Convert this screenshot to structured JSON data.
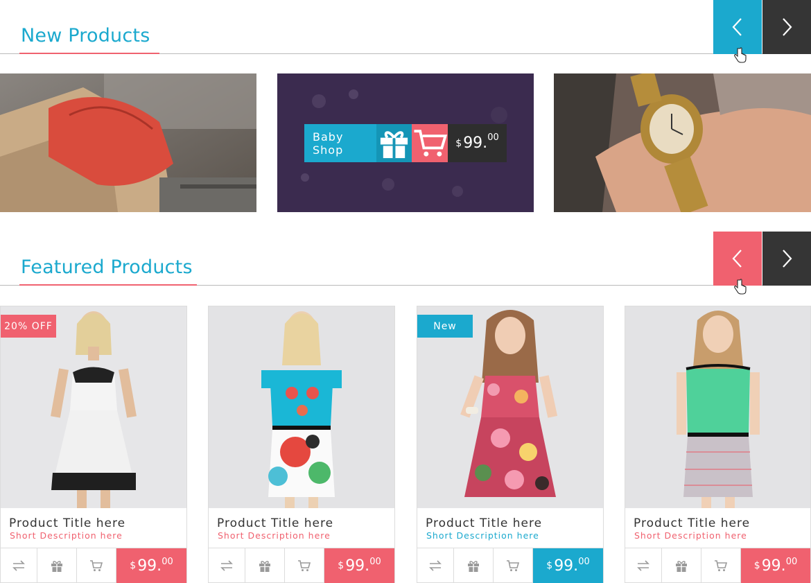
{
  "colors": {
    "accent_blue": "#1ba9ce",
    "accent_pink": "#f0616f",
    "dark": "#353535"
  },
  "new_products": {
    "title": "New Products",
    "prev_icon": "chevron-left-icon",
    "next_icon": "chevron-right-icon",
    "banners": [
      {
        "image": "red-handbag-photo"
      },
      {
        "image": "baby-shop-photo",
        "overlay": {
          "label": "Baby Shop",
          "currency": "$",
          "price_main": "99.",
          "price_cents": "00"
        }
      },
      {
        "image": "gold-wristwatch-photo"
      }
    ]
  },
  "featured_products": {
    "title": "Featured Products",
    "prev_icon": "chevron-left-icon",
    "next_icon": "chevron-right-icon",
    "products": [
      {
        "badge": "20% OFF",
        "title": "Product Title here",
        "desc": "Short Description here",
        "currency": "$",
        "price_main": "99.",
        "price_cents": "00",
        "image": "white-lace-dress-photo"
      },
      {
        "badge": "",
        "title": "Product Title here",
        "desc": "Short Description here",
        "currency": "$",
        "price_main": "99.",
        "price_cents": "00",
        "image": "blue-floral-top-photo"
      },
      {
        "badge": "New",
        "title": "Product Title here",
        "desc": "Short Description here",
        "currency": "$",
        "price_main": "99.",
        "price_cents": "00",
        "image": "floral-dress-photo"
      },
      {
        "badge": "",
        "title": "Product Title here",
        "desc": "Short Description here",
        "currency": "$",
        "price_main": "99.",
        "price_cents": "00",
        "image": "green-knit-dress-photo"
      }
    ]
  }
}
